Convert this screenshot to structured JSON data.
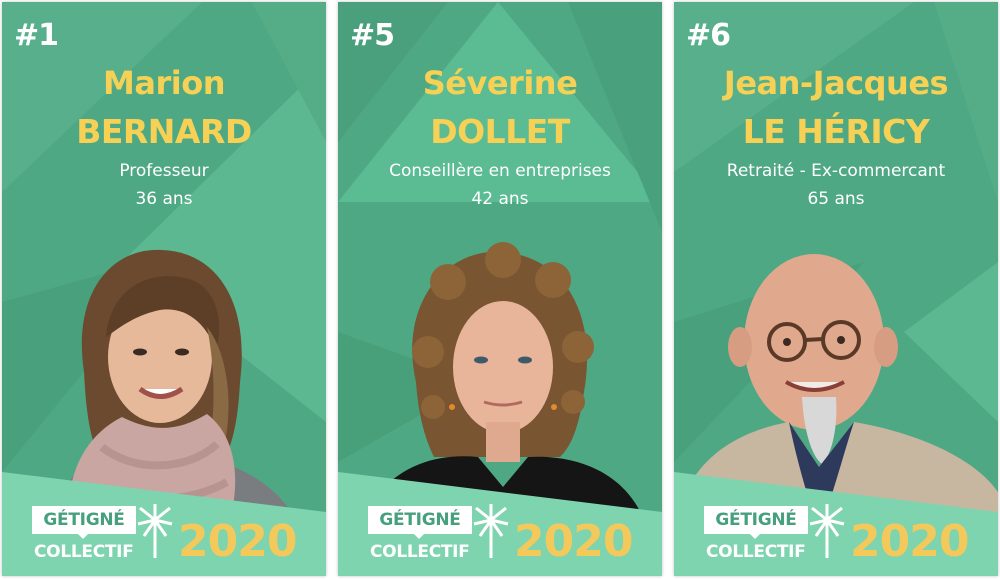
{
  "colors": {
    "card_green": "#4fa884",
    "name_yellow": "#f6d155",
    "year_yellow": "#f2c95a",
    "footer_mint": "#7fd4b0",
    "white": "#ffffff"
  },
  "logo": {
    "line1": "GÉTIGNÉ",
    "line2": "COLLECTIF",
    "year": "2020",
    "icon": "palm-tree-icon"
  },
  "candidates": [
    {
      "number": "#1",
      "first_name": "Marion",
      "last_name": "BERNARD",
      "job": "Professeur",
      "age": "36 ans"
    },
    {
      "number": "#5",
      "first_name": "Séverine",
      "last_name": "DOLLET",
      "job": "Conseillère en entreprises",
      "age": "42 ans"
    },
    {
      "number": "#6",
      "first_name": "Jean-Jacques",
      "last_name": "LE HÉRICY",
      "job": "Retraité - Ex-commercant",
      "age": "65 ans"
    }
  ]
}
